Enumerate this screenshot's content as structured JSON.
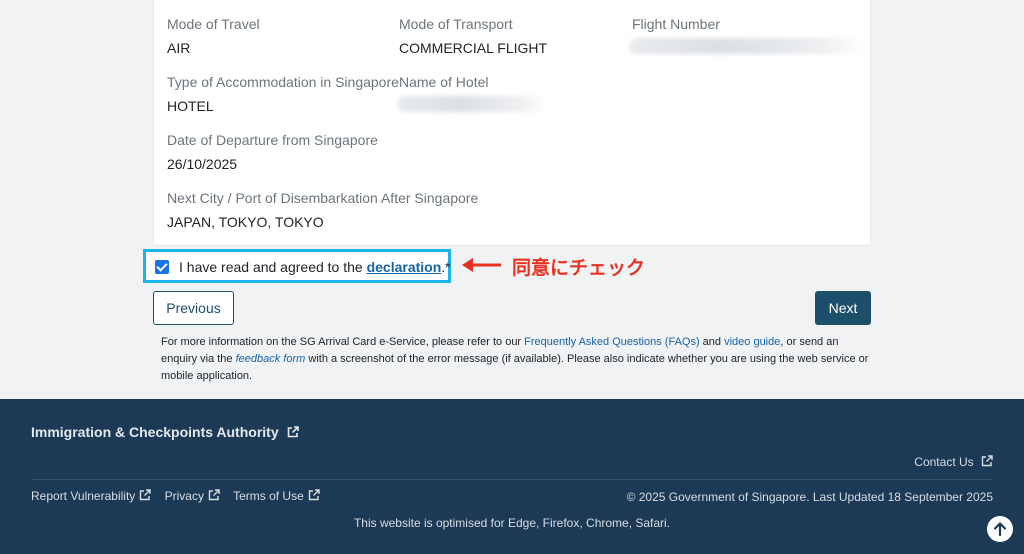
{
  "fields": {
    "mode_of_travel": {
      "label": "Mode of Travel",
      "value": "AIR"
    },
    "mode_of_transport": {
      "label": "Mode of Transport",
      "value": "COMMERCIAL FLIGHT"
    },
    "flight_number": {
      "label": "Flight Number"
    },
    "accommodation_type": {
      "label": "Type of Accommodation in Singapore",
      "value": "HOTEL"
    },
    "hotel_name": {
      "label": "Name of Hotel"
    },
    "departure_date": {
      "label": "Date of Departure from Singapore",
      "value": "26/10/2025"
    },
    "next_city": {
      "label": "Next City / Port of Disembarkation After Singapore",
      "value": "JAPAN, TOKYO, TOKYO"
    }
  },
  "declaration": {
    "text_before": "I have read and agreed to the ",
    "link": "declaration",
    "text_after": ".*",
    "checked": true
  },
  "annotation": {
    "text": "同意にチェック",
    "color": "#e8321f"
  },
  "buttons": {
    "previous": "Previous",
    "next": "Next"
  },
  "info": {
    "part1": "For more information on the SG Arrival Card e-Service, please refer to our ",
    "faq_link": "Frequently Asked Questions (FAQs)",
    "part2": " and ",
    "video_link": "video guide",
    "part3": ", or send an enquiry via the ",
    "feedback_link": "feedback form",
    "part4": " with a screenshot of the error message (if available). Please also indicate whether you are using the web service or mobile application."
  },
  "footer": {
    "ica": "Immigration & Checkpoints Authority",
    "contact": "Contact Us",
    "links": [
      "Report Vulnerability",
      "Privacy",
      "Terms of Use"
    ],
    "copyright": "© 2025 Government of Singapore.  Last Updated 18 September 2025",
    "optimised": "This website is optimised for Edge, Firefox, Chrome, Safari."
  },
  "colors": {
    "primary": "#1d4f6b",
    "footer_bg": "#1c3a55",
    "link": "#1763a6",
    "highlight_border": "#1bb5e8"
  },
  "icons": {
    "external": "external-link-icon",
    "back_to_top": "arrow-up-icon",
    "annotation_arrow": "red-left-arrow-icon"
  }
}
